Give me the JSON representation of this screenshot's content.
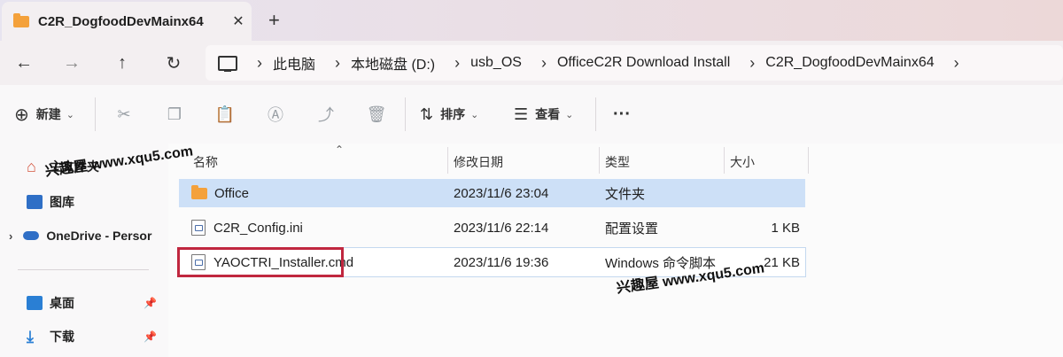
{
  "tab": {
    "title": "C2R_DogfoodDevMainx64",
    "close": "✕"
  },
  "newtab": "+",
  "nav": {
    "back": "←",
    "forward": "→",
    "up": "↑",
    "refresh": "↻"
  },
  "breadcrumbs": [
    "此电脑",
    "本地磁盘 (D:)",
    "usb_OS",
    "OfficeC2R Download Install",
    "C2R_DogfoodDevMainx64"
  ],
  "toolbar": {
    "new_label": "新建",
    "sort_label": "排序",
    "view_label": "查看",
    "more_label": "···"
  },
  "sidebar": {
    "items": [
      {
        "label": "主文件夹"
      },
      {
        "label": "图库"
      },
      {
        "label": "OneDrive - Persor"
      },
      {
        "label": "桌面"
      },
      {
        "label": "下载"
      }
    ]
  },
  "columns": {
    "name": "名称",
    "date": "修改日期",
    "type": "类型",
    "size": "大小"
  },
  "files": [
    {
      "name": "Office",
      "date": "2023/11/6 23:04",
      "type": "文件夹",
      "size": ""
    },
    {
      "name": "C2R_Config.ini",
      "date": "2023/11/6 22:14",
      "type": "配置设置",
      "size": "1 KB"
    },
    {
      "name": "YAOCTRI_Installer.cmd",
      "date": "2023/11/6 19:36",
      "type": "Windows 命令脚本",
      "size": "21 KB"
    }
  ],
  "watermarks": [
    "兴趣屋 www.xqu5.com",
    "兴趣屋 www.xqu5.com"
  ],
  "colors": {
    "folder": "#f4a13b",
    "selection": "#cde0f7",
    "highlight_box": "#c0273f"
  }
}
